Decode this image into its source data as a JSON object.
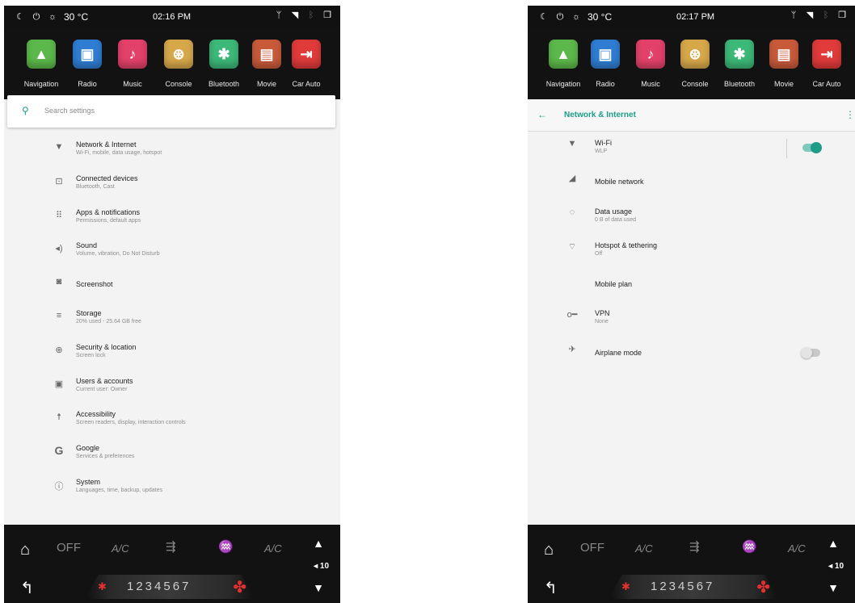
{
  "screens": [
    {
      "status": {
        "temperature": "30 °C",
        "time": "02:16 PM"
      },
      "apps": [
        {
          "label": "Navigation",
          "icon": "navigation-arrow-icon",
          "color": "#5cb84a",
          "glyph": "▲"
        },
        {
          "label": "Radio",
          "icon": "radio-icon",
          "color": "#2f7dd3",
          "glyph": "▣"
        },
        {
          "label": "Music",
          "icon": "music-note-icon",
          "color": "#e3416a",
          "glyph": "♪"
        },
        {
          "label": "Console",
          "icon": "steering-wheel-icon",
          "color": "#d7a84a",
          "glyph": "⊛"
        },
        {
          "label": "Bluetooth",
          "icon": "bluetooth-icon",
          "color": "#3cb878",
          "glyph": "✱"
        },
        {
          "label": "Movie",
          "icon": "film-icon",
          "color": "#c85a3a",
          "glyph": "▤"
        },
        {
          "label": "Car Auto",
          "icon": "car-auto-icon",
          "color": "#e03a3a",
          "glyph": "⇥"
        }
      ],
      "search": {
        "placeholder": "Search settings"
      },
      "settings": [
        {
          "icon": "wifi-icon",
          "glyph": "▼",
          "title": "Network & Internet",
          "sub": "Wi-Fi, mobile, data usage, hotspot"
        },
        {
          "icon": "devices-icon",
          "glyph": "⊡",
          "title": "Connected devices",
          "sub": "Bluetooth, Cast"
        },
        {
          "icon": "apps-grid-icon",
          "glyph": "⠿",
          "title": "Apps & notifications",
          "sub": "Permissions, default apps"
        },
        {
          "icon": "volume-icon",
          "glyph": "◂)",
          "title": "Sound",
          "sub": "Volume, vibration, Do Not Disturb"
        },
        {
          "icon": "screenshot-icon",
          "glyph": "◙",
          "title": "Screenshot",
          "sub": ""
        },
        {
          "icon": "storage-icon",
          "glyph": "≡",
          "title": "Storage",
          "sub": "20% used - 25.64 GB free"
        },
        {
          "icon": "lock-icon",
          "glyph": "⊕",
          "title": "Security & location",
          "sub": "Screen lock"
        },
        {
          "icon": "account-icon",
          "glyph": "▣",
          "title": "Users & accounts",
          "sub": "Current user: Owner"
        },
        {
          "icon": "accessibility-icon",
          "glyph": "☨",
          "title": "Accessibility",
          "sub": "Screen readers, display, interaction controls"
        },
        {
          "icon": "google-icon",
          "glyph": "G",
          "title": "Google",
          "sub": "Services & preferences"
        },
        {
          "icon": "info-icon",
          "glyph": "ⓘ",
          "title": "System",
          "sub": "Languages, time, backup, updates"
        }
      ],
      "climate": {
        "off": "OFF",
        "ac_left": "A/C",
        "ac_right": "A/C",
        "fan_speeds": "1234567",
        "volume": "◂ 10"
      }
    },
    {
      "status": {
        "temperature": "30 °C",
        "time": "02:17 PM"
      },
      "apps": [
        {
          "label": "Navigation",
          "icon": "navigation-arrow-icon",
          "color": "#5cb84a",
          "glyph": "▲"
        },
        {
          "label": "Radio",
          "icon": "radio-icon",
          "color": "#2f7dd3",
          "glyph": "▣"
        },
        {
          "label": "Music",
          "icon": "music-note-icon",
          "color": "#e3416a",
          "glyph": "♪"
        },
        {
          "label": "Console",
          "icon": "steering-wheel-icon",
          "color": "#d7a84a",
          "glyph": "⊛"
        },
        {
          "label": "Bluetooth",
          "icon": "bluetooth-icon",
          "color": "#3cb878",
          "glyph": "✱"
        },
        {
          "label": "Movie",
          "icon": "film-icon",
          "color": "#c85a3a",
          "glyph": "▤"
        },
        {
          "label": "Car Auto",
          "icon": "car-auto-icon",
          "color": "#e03a3a",
          "glyph": "⇥"
        }
      ],
      "header": {
        "title": "Network & Internet"
      },
      "network": [
        {
          "icon": "wifi-icon",
          "glyph": "▼",
          "title": "Wi-Fi",
          "sub": "WLP",
          "toggle": "on"
        },
        {
          "icon": "signal-icon",
          "glyph": "◢",
          "title": "Mobile network",
          "sub": ""
        },
        {
          "icon": "data-usage-icon",
          "glyph": "◌",
          "title": "Data usage",
          "sub": "0 B of data used"
        },
        {
          "icon": "hotspot-icon",
          "glyph": "⌔",
          "title": "Hotspot & tethering",
          "sub": "Off"
        },
        {
          "icon": "",
          "glyph": "",
          "title": "Mobile plan",
          "sub": ""
        },
        {
          "icon": "vpn-key-icon",
          "glyph": "o━",
          "title": "VPN",
          "sub": "None"
        },
        {
          "icon": "airplane-icon",
          "glyph": "✈",
          "title": "Airplane mode",
          "sub": "",
          "toggle": "off"
        }
      ],
      "climate": {
        "off": "OFF",
        "ac_left": "A/C",
        "ac_right": "A/C",
        "fan_speeds": "1234567",
        "volume": "◂ 10"
      }
    }
  ],
  "colors": {
    "accent": "#1e9c88",
    "background": "#f3f3f3",
    "bar": "#121212"
  }
}
